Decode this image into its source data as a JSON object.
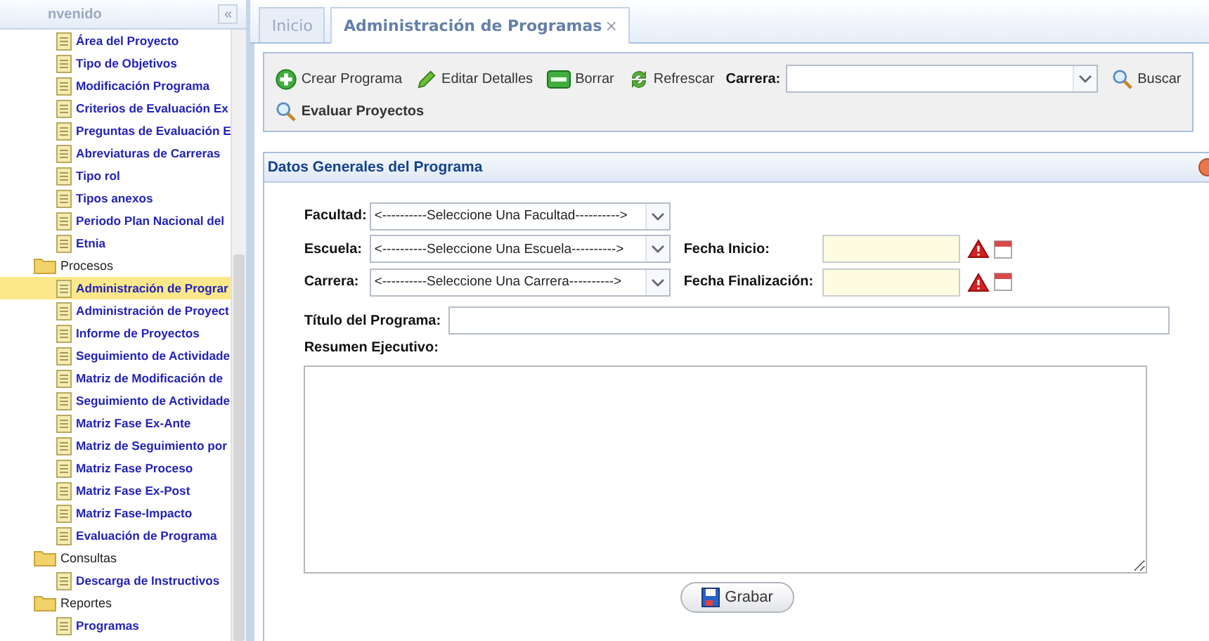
{
  "sidebar": {
    "title": "nvenido",
    "collapse": "«",
    "tree": [
      {
        "kind": "page",
        "label": "Área del Proyecto",
        "selected": false
      },
      {
        "kind": "page",
        "label": "Tipo de Objetivos",
        "selected": false
      },
      {
        "kind": "page",
        "label": "Modificación Programa",
        "selected": false
      },
      {
        "kind": "page",
        "label": "Criterios de Evaluación Ex",
        "selected": false
      },
      {
        "kind": "page",
        "label": "Preguntas de Evaluación E",
        "selected": false
      },
      {
        "kind": "page",
        "label": "Abreviaturas de Carreras",
        "selected": false
      },
      {
        "kind": "page",
        "label": "Tipo rol",
        "selected": false
      },
      {
        "kind": "page",
        "label": "Tipos anexos",
        "selected": false
      },
      {
        "kind": "page",
        "label": "Periodo Plan Nacional del",
        "selected": false
      },
      {
        "kind": "page",
        "label": "Etnia",
        "selected": false
      },
      {
        "kind": "folder",
        "label": "Procesos",
        "children": [
          {
            "kind": "page",
            "label": "Administración de Prograr",
            "selected": true
          },
          {
            "kind": "page",
            "label": "Administración de Proyect",
            "selected": false
          },
          {
            "kind": "page",
            "label": "Informe de Proyectos",
            "selected": false
          },
          {
            "kind": "page",
            "label": "Seguimiento de Actividade",
            "selected": false
          },
          {
            "kind": "page",
            "label": "Matriz de Modificación de",
            "selected": false
          },
          {
            "kind": "page",
            "label": "Seguimiento de Actividade",
            "selected": false
          },
          {
            "kind": "page",
            "label": "Matriz Fase Ex-Ante",
            "selected": false
          },
          {
            "kind": "page",
            "label": "Matriz de Seguimiento por",
            "selected": false
          },
          {
            "kind": "page",
            "label": "Matriz Fase Proceso",
            "selected": false
          },
          {
            "kind": "page",
            "label": "Matriz Fase Ex-Post",
            "selected": false
          },
          {
            "kind": "page",
            "label": "Matriz Fase-Impacto",
            "selected": false
          },
          {
            "kind": "page",
            "label": "Evaluación de Programa",
            "selected": false
          }
        ]
      },
      {
        "kind": "folder",
        "label": "Consultas",
        "children": [
          {
            "kind": "page",
            "label": "Descarga de Instructivos",
            "selected": false
          }
        ]
      },
      {
        "kind": "folder",
        "label": "Reportes",
        "children": [
          {
            "kind": "page",
            "label": "Programas",
            "selected": false
          }
        ]
      }
    ]
  },
  "tabs": [
    {
      "label": "Inicio",
      "selected": false
    },
    {
      "label": "Administración de Programas",
      "selected": true,
      "close": "×"
    }
  ],
  "toolbar": {
    "buttons": [
      {
        "kind": "add",
        "label": "Crear Programa"
      },
      {
        "kind": "edit",
        "label": "Editar Detalles"
      },
      {
        "kind": "delete",
        "label": "Borrar"
      },
      {
        "kind": "refresh",
        "label": "Refrescar"
      }
    ],
    "carrera_label": "Carrera:",
    "search": "Buscar",
    "evaluate": "Evaluar Proyectos"
  },
  "form": {
    "title": "Datos Generales del Programa",
    "facultad": {
      "label": "Facultad:",
      "value": "<----------Seleccione Una Facultad---------->"
    },
    "escuela": {
      "label": "Escuela:",
      "value": "<----------Seleccione Una Escuela---------->"
    },
    "carrera": {
      "label": "Carrera:",
      "value": "<----------Seleccione Una Carrera---------->"
    },
    "fecha_inicio": {
      "label": "Fecha Inicio:"
    },
    "fecha_fin": {
      "label": "Fecha Finalización:"
    },
    "titulo": {
      "label": "Título del Programa:"
    },
    "resumen": {
      "label": "Resumen Ejecutivo:"
    },
    "save": "Grabar"
  }
}
